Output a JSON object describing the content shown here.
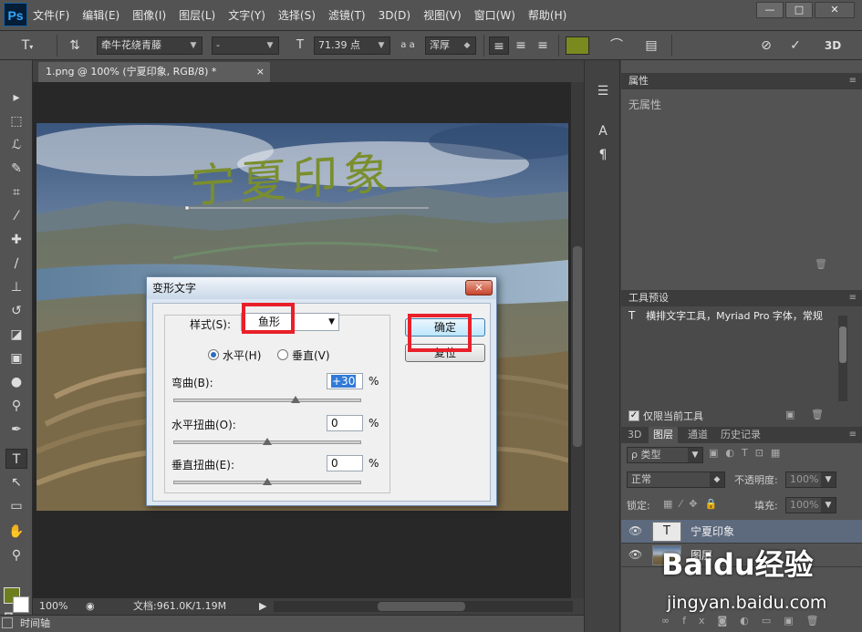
{
  "app": {
    "logo": "Ps"
  },
  "menu": [
    "文件(F)",
    "编辑(E)",
    "图像(I)",
    "图层(L)",
    "文字(Y)",
    "选择(S)",
    "滤镜(T)",
    "3D(D)",
    "视图(V)",
    "窗口(W)",
    "帮助(H)"
  ],
  "window_controls": {
    "minimize": "—",
    "restore": "□",
    "close": "✕"
  },
  "options_bar": {
    "font_family": "牵牛花绕青藤",
    "font_style": "-",
    "font_size": "71.39 点",
    "aa_label": "a a",
    "anti_alias": "浑厚",
    "text_color": "#7b8a1e",
    "three_d": "3D"
  },
  "document": {
    "tab_title": "1.png @ 100% (宁夏印象, RGB/8) *",
    "close_glyph": "×",
    "canvas_text": "宁夏印象",
    "canvas_text_color": "#7a8e2e"
  },
  "status": {
    "zoom": "100%",
    "doc_size": "文档:961.0K/1.19M"
  },
  "timeline": {
    "label": "时间轴"
  },
  "dialog": {
    "title": "变形文字",
    "style_label": "样式(S):",
    "style_value": "鱼形",
    "horizontal_label": "水平(H)",
    "vertical_label": "垂直(V)",
    "bend_label": "弯曲(B):",
    "bend_value": "+30",
    "hdist_label": "水平扭曲(O):",
    "hdist_value": "0",
    "vdist_label": "垂直扭曲(E):",
    "vdist_value": "0",
    "percent": "%",
    "ok_label": "确定",
    "reset_label": "复位",
    "bend_level_percent": 30,
    "hdist_level_percent": 0,
    "vdist_level_percent": 0
  },
  "properties_panel": {
    "title": "属性",
    "content": "无属性"
  },
  "tool_presets_panel": {
    "title": "工具预设",
    "item": "横排文字工具，Myriad Pro 字体，常规",
    "current_only": "仅限当前工具"
  },
  "layers_panel": {
    "tabs": [
      "3D",
      "图层",
      "通道",
      "历史记录"
    ],
    "filter_label": "ρ 类型",
    "blend_mode": "正常",
    "opacity_label": "不透明度:",
    "opacity_value": "100%",
    "lock_label": "锁定:",
    "fill_label": "填充:",
    "fill_value": "100%",
    "layers": [
      {
        "name": "宁夏印象",
        "thumb": "T"
      },
      {
        "name": "图层",
        "thumb": ""
      }
    ]
  },
  "watermark": {
    "brand": "Baidu经验",
    "url": "jingyan.baidu.com"
  }
}
